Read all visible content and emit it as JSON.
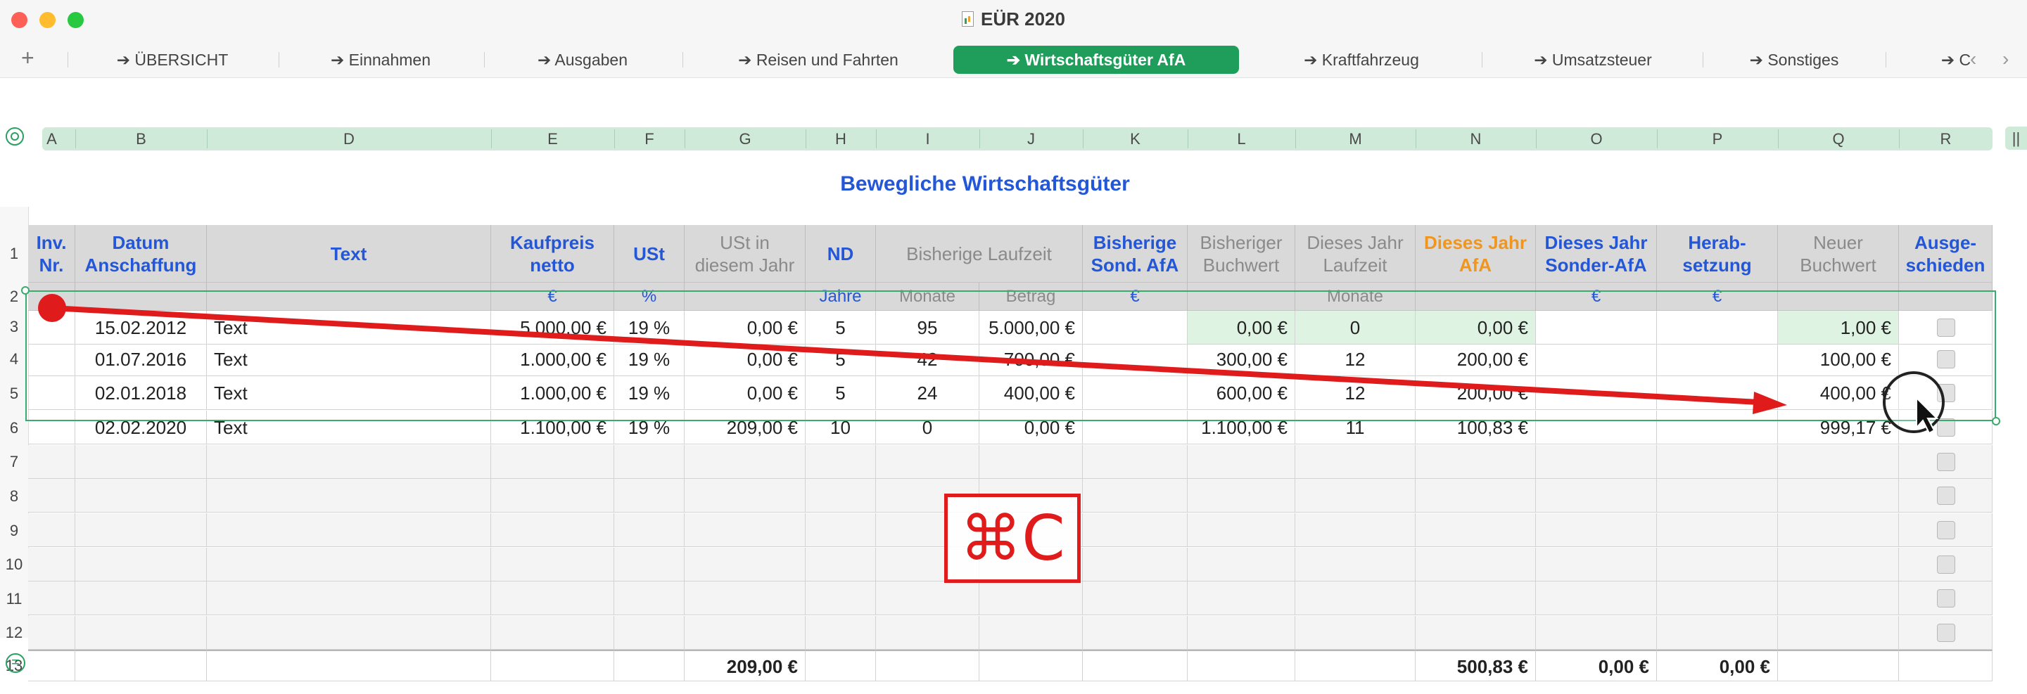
{
  "window": {
    "title": "EÜR 2020",
    "add_tab_label": "+"
  },
  "tabs": [
    {
      "label": "➔ ÜBERSICHT",
      "active": false
    },
    {
      "label": "➔ Einnahmen",
      "active": false
    },
    {
      "label": "➔ Ausgaben",
      "active": false
    },
    {
      "label": "➔ Reisen und Fahrten",
      "active": false
    },
    {
      "label": "➔ Wirtschaftsgüter AfA",
      "active": true
    },
    {
      "label": "➔ Kraftfahrzeug",
      "active": false
    },
    {
      "label": "➔ Umsatzsteuer",
      "active": false
    },
    {
      "label": "➔ Sonstiges",
      "active": false
    },
    {
      "label": "➔ C",
      "active": false
    }
  ],
  "columns": [
    "A",
    "B",
    "D",
    "E",
    "F",
    "G",
    "H",
    "I",
    "J",
    "K",
    "L",
    "M",
    "N",
    "O",
    "P",
    "Q",
    "R"
  ],
  "table": {
    "title": "Bewegliche Wirtschaftsgüter",
    "headers": {
      "inv": "Inv.\nNr.",
      "datum": "Datum\nAnschaffung",
      "text": "Text",
      "kaufpreis": "Kaufpreis\nnetto",
      "ust": "USt",
      "ust_jahr": "USt in\ndiesem Jahr",
      "nd": "ND",
      "bisherige_laufzeit": "Bisherige Laufzeit",
      "sond_afa": "Bisherige\nSond. AfA",
      "bisheriger_buchwert": "Bisheriger\nBuchwert",
      "dieses_jahr_laufzeit": "Dieses Jahr\nLaufzeit",
      "dieses_jahr_afa": "Dieses Jahr\nAfA",
      "sonder_afa": "Dieses Jahr\nSonder-AfA",
      "herabsetzung": "Herab-\nsetzung",
      "neuer_buchwert": "Neuer\nBuchwert",
      "ausgeschieden": "Ausge-\nschieden"
    },
    "units": {
      "kaufpreis": "€",
      "ust": "%",
      "nd": "Jahre",
      "monate": "Monate",
      "betrag": "Betrag",
      "sond_afa": "€",
      "dieses_jahr_laufzeit": "Monate",
      "sonder_afa": "€",
      "herabsetzung": "€"
    },
    "row_numbers": [
      "1",
      "2",
      "3",
      "4",
      "5",
      "6",
      "7",
      "8",
      "9",
      "10",
      "11",
      "12",
      "13"
    ],
    "rows": [
      {
        "datum": "15.02.2012",
        "text": "Text",
        "kaufpreis": "5.000,00 €",
        "ust": "19 %",
        "ust_jahr": "0,00 €",
        "nd": "5",
        "monate": "95",
        "betrag": "5.000,00 €",
        "sond_afa": "",
        "buchwert": "0,00 €",
        "laufzeit": "0",
        "afa": "0,00 €",
        "sonder_afa": "",
        "herabsetzung": "",
        "neuer_buchwert": "1,00 €"
      },
      {
        "datum": "01.07.2016",
        "text": "Text",
        "kaufpreis": "1.000,00 €",
        "ust": "19 %",
        "ust_jahr": "0,00 €",
        "nd": "5",
        "monate": "42",
        "betrag": "700,00 €",
        "sond_afa": "",
        "buchwert": "300,00 €",
        "laufzeit": "12",
        "afa": "200,00 €",
        "sonder_afa": "",
        "herabsetzung": "",
        "neuer_buchwert": "100,00 €"
      },
      {
        "datum": "02.01.2018",
        "text": "Text",
        "kaufpreis": "1.000,00 €",
        "ust": "19 %",
        "ust_jahr": "0,00 €",
        "nd": "5",
        "monate": "24",
        "betrag": "400,00 €",
        "sond_afa": "",
        "buchwert": "600,00 €",
        "laufzeit": "12",
        "afa": "200,00 €",
        "sonder_afa": "",
        "herabsetzung": "",
        "neuer_buchwert": "400,00 €"
      },
      {
        "datum": "02.02.2020",
        "text": "Text",
        "kaufpreis": "1.100,00 €",
        "ust": "19 %",
        "ust_jahr": "209,00 €",
        "nd": "10",
        "monate": "0",
        "betrag": "0,00 €",
        "sond_afa": "",
        "buchwert": "1.100,00 €",
        "laufzeit": "11",
        "afa": "100,83 €",
        "sonder_afa": "",
        "herabsetzung": "",
        "neuer_buchwert": "999,17 €"
      }
    ],
    "totals": {
      "ust_jahr": "209,00 €",
      "afa": "500,83 €",
      "sonder_afa": "0,00 €",
      "herabsetzung": "0,00 €"
    }
  },
  "overlay": {
    "shortcut": "⌘C"
  },
  "colors": {
    "accent_green": "#1e9e5a",
    "header_blue": "#2357d8",
    "afa_orange": "#f0961e",
    "annotation_red": "#e01b1b"
  }
}
